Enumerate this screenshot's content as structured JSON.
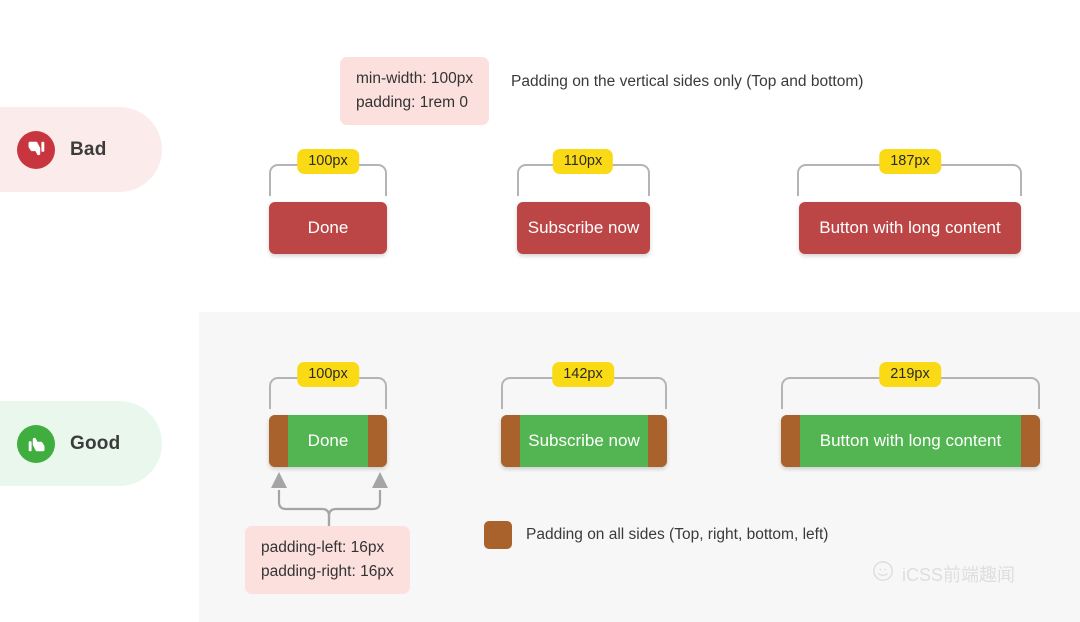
{
  "verdicts": {
    "bad": {
      "label": "Bad",
      "icon": "thumbs-down-icon"
    },
    "good": {
      "label": "Good",
      "icon": "thumbs-up-icon"
    }
  },
  "bad_section": {
    "code_chip": {
      "line1": "min-width: 100px",
      "line2": "padding: 1rem 0"
    },
    "caption": "Padding on the vertical sides only (Top and bottom)",
    "buttons": [
      {
        "label": "Done",
        "width_badge": "100px"
      },
      {
        "label": "Subscribe now",
        "width_badge": "110px"
      },
      {
        "label": "Button with long content",
        "width_badge": "187px"
      }
    ]
  },
  "good_section": {
    "buttons": [
      {
        "label": "Done",
        "width_badge": "100px"
      },
      {
        "label": "Subscribe now",
        "width_badge": "142px"
      },
      {
        "label": "Button with long content",
        "width_badge": "219px"
      }
    ],
    "padding_chip": {
      "line1": "padding-left: 16px",
      "line2": "padding-right: 16px"
    },
    "legend": {
      "text": "Padding on all sides (Top, right, bottom, left)",
      "swatch_color": "#a9622c"
    }
  },
  "watermark": {
    "text": "iCSS前端趣闻",
    "icon": "wechat-icon"
  },
  "colors": {
    "red_button": "#bc4545",
    "green_content": "#52b552",
    "brown_padding": "#a9622c",
    "yellow_badge": "#fada15",
    "pink_chip": "#fbe0de",
    "bad_pill": "#fbeceb",
    "good_pill": "#eaf7ec",
    "band_good": "#f7f7f7"
  }
}
